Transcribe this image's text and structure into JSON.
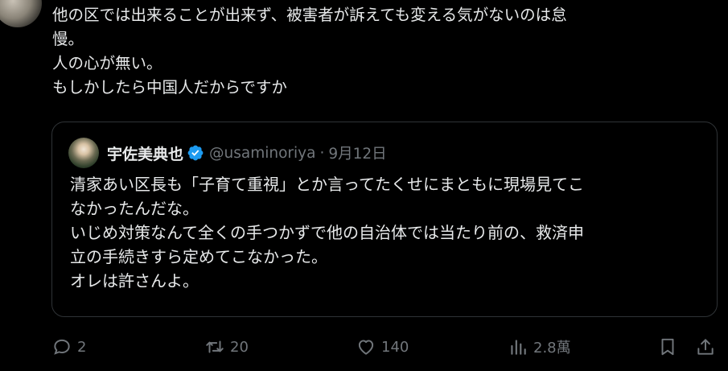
{
  "tweet": {
    "lines": [
      "他の区では出来ることが出来ず、被害者が訴えても変える気がないのは怠",
      "慢。",
      "人の心が無い。",
      "もしかしたら中国人だからですか"
    ]
  },
  "quote": {
    "author_name": "宇佐美典也",
    "handle": "@usaminoriya",
    "separator": "·",
    "date": "9月12日",
    "lines": [
      "清家あい区長も「子育て重視」とか言ってたくせにまともに現場見てこ",
      "なかったんだな。",
      "いじめ対策なんて全くの手つかずで他の自治体では当たり前の、救済申",
      "立の手続きすら定めてこなかった。",
      "オレは許さんよ。"
    ]
  },
  "actions": {
    "reply_count": "2",
    "repost_count": "20",
    "like_count": "140",
    "view_count": "2.8萬"
  },
  "icons": {
    "reply": "reply-icon",
    "repost": "repost-icon",
    "like": "heart-icon",
    "views": "views-icon",
    "bookmark": "bookmark-icon",
    "share": "share-icon",
    "verified": "verified-badge-icon"
  },
  "colors": {
    "background": "#000000",
    "text": "#e7e9ea",
    "muted": "#71767b",
    "border": "#2f3336",
    "verified": "#1d9bf0"
  }
}
